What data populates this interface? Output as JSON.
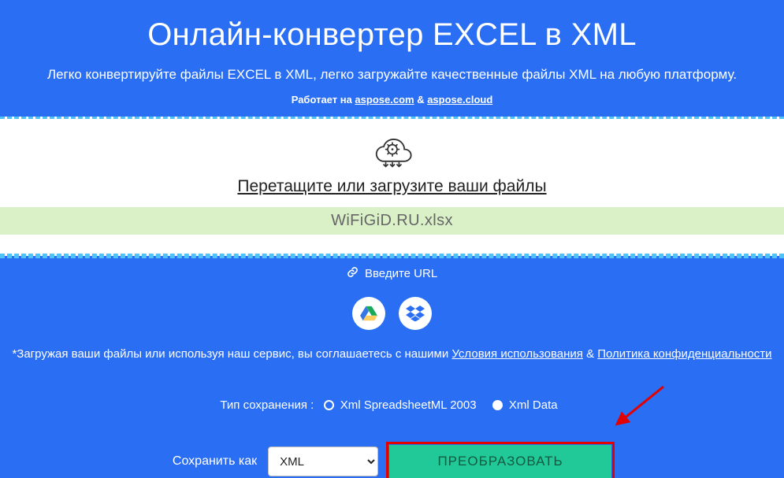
{
  "title": "Онлайн-конвертер EXCEL в XML",
  "subtitle": "Легко конвертируйте файлы EXCEL в XML, легко загружайте качественные файлы XML на любую платформу.",
  "powered": {
    "prefix": "Работает на ",
    "link1": "aspose.com",
    "sep": " & ",
    "link2": "aspose.cloud"
  },
  "drop": {
    "prompt": "Перетащите или загрузите ваши файлы",
    "uploaded_file": "WiFiGiD.RU.xlsx"
  },
  "url_input_label": "Введите URL",
  "disclaimer": {
    "prefix": "*Загружая ваши файлы или используя наш сервис, вы соглашаетесь с нашими ",
    "terms": "Условия использования",
    "sep": " & ",
    "privacy": "Политика конфиденциальности"
  },
  "save_type": {
    "label": "Тип сохранения :",
    "opt1": "Xml SpreadsheetML 2003",
    "opt2": "Xml Data"
  },
  "action": {
    "save_as_label": "Сохранить как",
    "format_option": "XML",
    "convert_label": "ПРЕОБРАЗОВАТЬ"
  }
}
